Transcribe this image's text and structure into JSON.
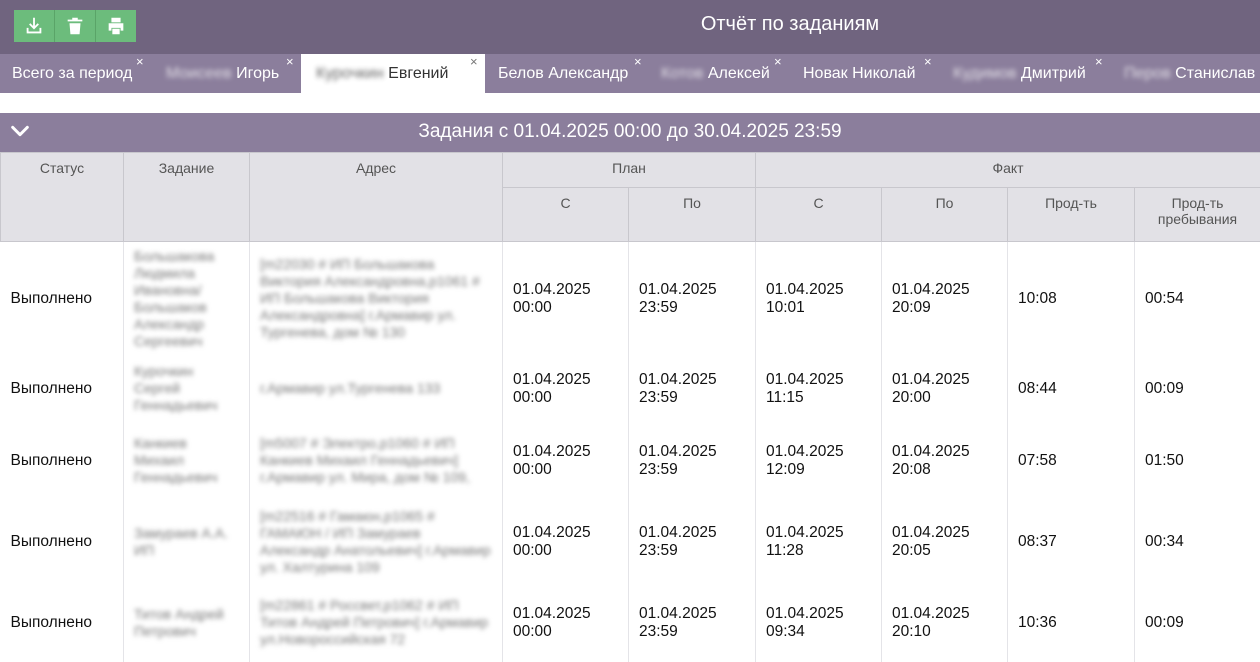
{
  "toolbar": {
    "icons": [
      "download-icon",
      "trash-icon",
      "print-icon"
    ]
  },
  "header": {
    "title": "Отчёт по заданиям"
  },
  "tabs": [
    {
      "prefix": "",
      "label": "Всего за период"
    },
    {
      "prefix": "Моисеев",
      "label": "Игорь"
    },
    {
      "prefix": "Курочкин",
      "label": "Евгений"
    },
    {
      "prefix": "",
      "label": "Белов Александр"
    },
    {
      "prefix": "Котов",
      "label": "Алексей"
    },
    {
      "prefix": "",
      "label": "Новак Николай"
    },
    {
      "prefix": "Кудимов",
      "label": "Дмитрий"
    },
    {
      "prefix": "Перов",
      "label": "Станислав"
    }
  ],
  "tab_close": "×",
  "section": {
    "title": "Задания с 01.04.2025 00:00 до 30.04.2025 23:59"
  },
  "table": {
    "headers": {
      "status": "Статус",
      "task": "Задание",
      "address": "Адрес",
      "plan": "План",
      "fact": "Факт",
      "plan_from": "С",
      "plan_to": "По",
      "fact_from": "С",
      "fact_to": "По",
      "duration": "Прод-ть",
      "stay": "Прод-ть пребывания"
    },
    "rows": [
      {
        "status": "Выполнено",
        "task": "Большакова Людмила Ивановна/ Большаков Александр Сергеевич",
        "address": "[m22030 # ИП Большакова Виктория Александровна,p1061 # ИП Большакова Виктория Александровна] г.Армавир ул. Тургенева, дом № 130",
        "plan_from": "01.04.2025 00:00",
        "plan_to": "01.04.2025 23:59",
        "fact_from": "01.04.2025 10:01",
        "fact_to": "01.04.2025 20:09",
        "duration": "10:08",
        "stay": "00:54"
      },
      {
        "status": "Выполнено",
        "task": "Курочкин Сергей Геннадьевич",
        "address": "г.Армавир ул.Тургенева 133",
        "plan_from": "01.04.2025 00:00",
        "plan_to": "01.04.2025 23:59",
        "fact_from": "01.04.2025 11:15",
        "fact_to": "01.04.2025 20:00",
        "duration": "08:44",
        "stay": "00:09"
      },
      {
        "status": "Выполнено",
        "task": "Канкиев Михаил Геннадьевич",
        "address": "[m5007 # Электро,p1060 # ИП Канкиев Михаил Геннадьевич] г.Армавир ул. Мира, дом № 109,",
        "plan_from": "01.04.2025 00:00",
        "plan_to": "01.04.2025 23:59",
        "fact_from": "01.04.2025 12:09",
        "fact_to": "01.04.2025 20:08",
        "duration": "07:58",
        "stay": "01:50"
      },
      {
        "status": "Выполнено",
        "task": "Замураев А.А. ИП",
        "address": "[m22516 # Гамаюн,p1065 # ГАМАЮН / ИП Замураев Александр Анатольевич] г.Армавир ул. Халтурина 109",
        "plan_from": "01.04.2025 00:00",
        "plan_to": "01.04.2025 23:59",
        "fact_from": "01.04.2025 11:28",
        "fact_to": "01.04.2025 20:05",
        "duration": "08:37",
        "stay": "00:34"
      },
      {
        "status": "Выполнено",
        "task": "Титов Андрей Петрович",
        "address": "[m22861 # Россвет,p1062 # ИП Титов Андрей Петрович] г.Армавир ул.Новороссийская 72",
        "plan_from": "01.04.2025 00:00",
        "plan_to": "01.04.2025 23:59",
        "fact_from": "01.04.2025 09:34",
        "fact_to": "01.04.2025 20:10",
        "duration": "10:36",
        "stay": "00:09"
      }
    ]
  }
}
